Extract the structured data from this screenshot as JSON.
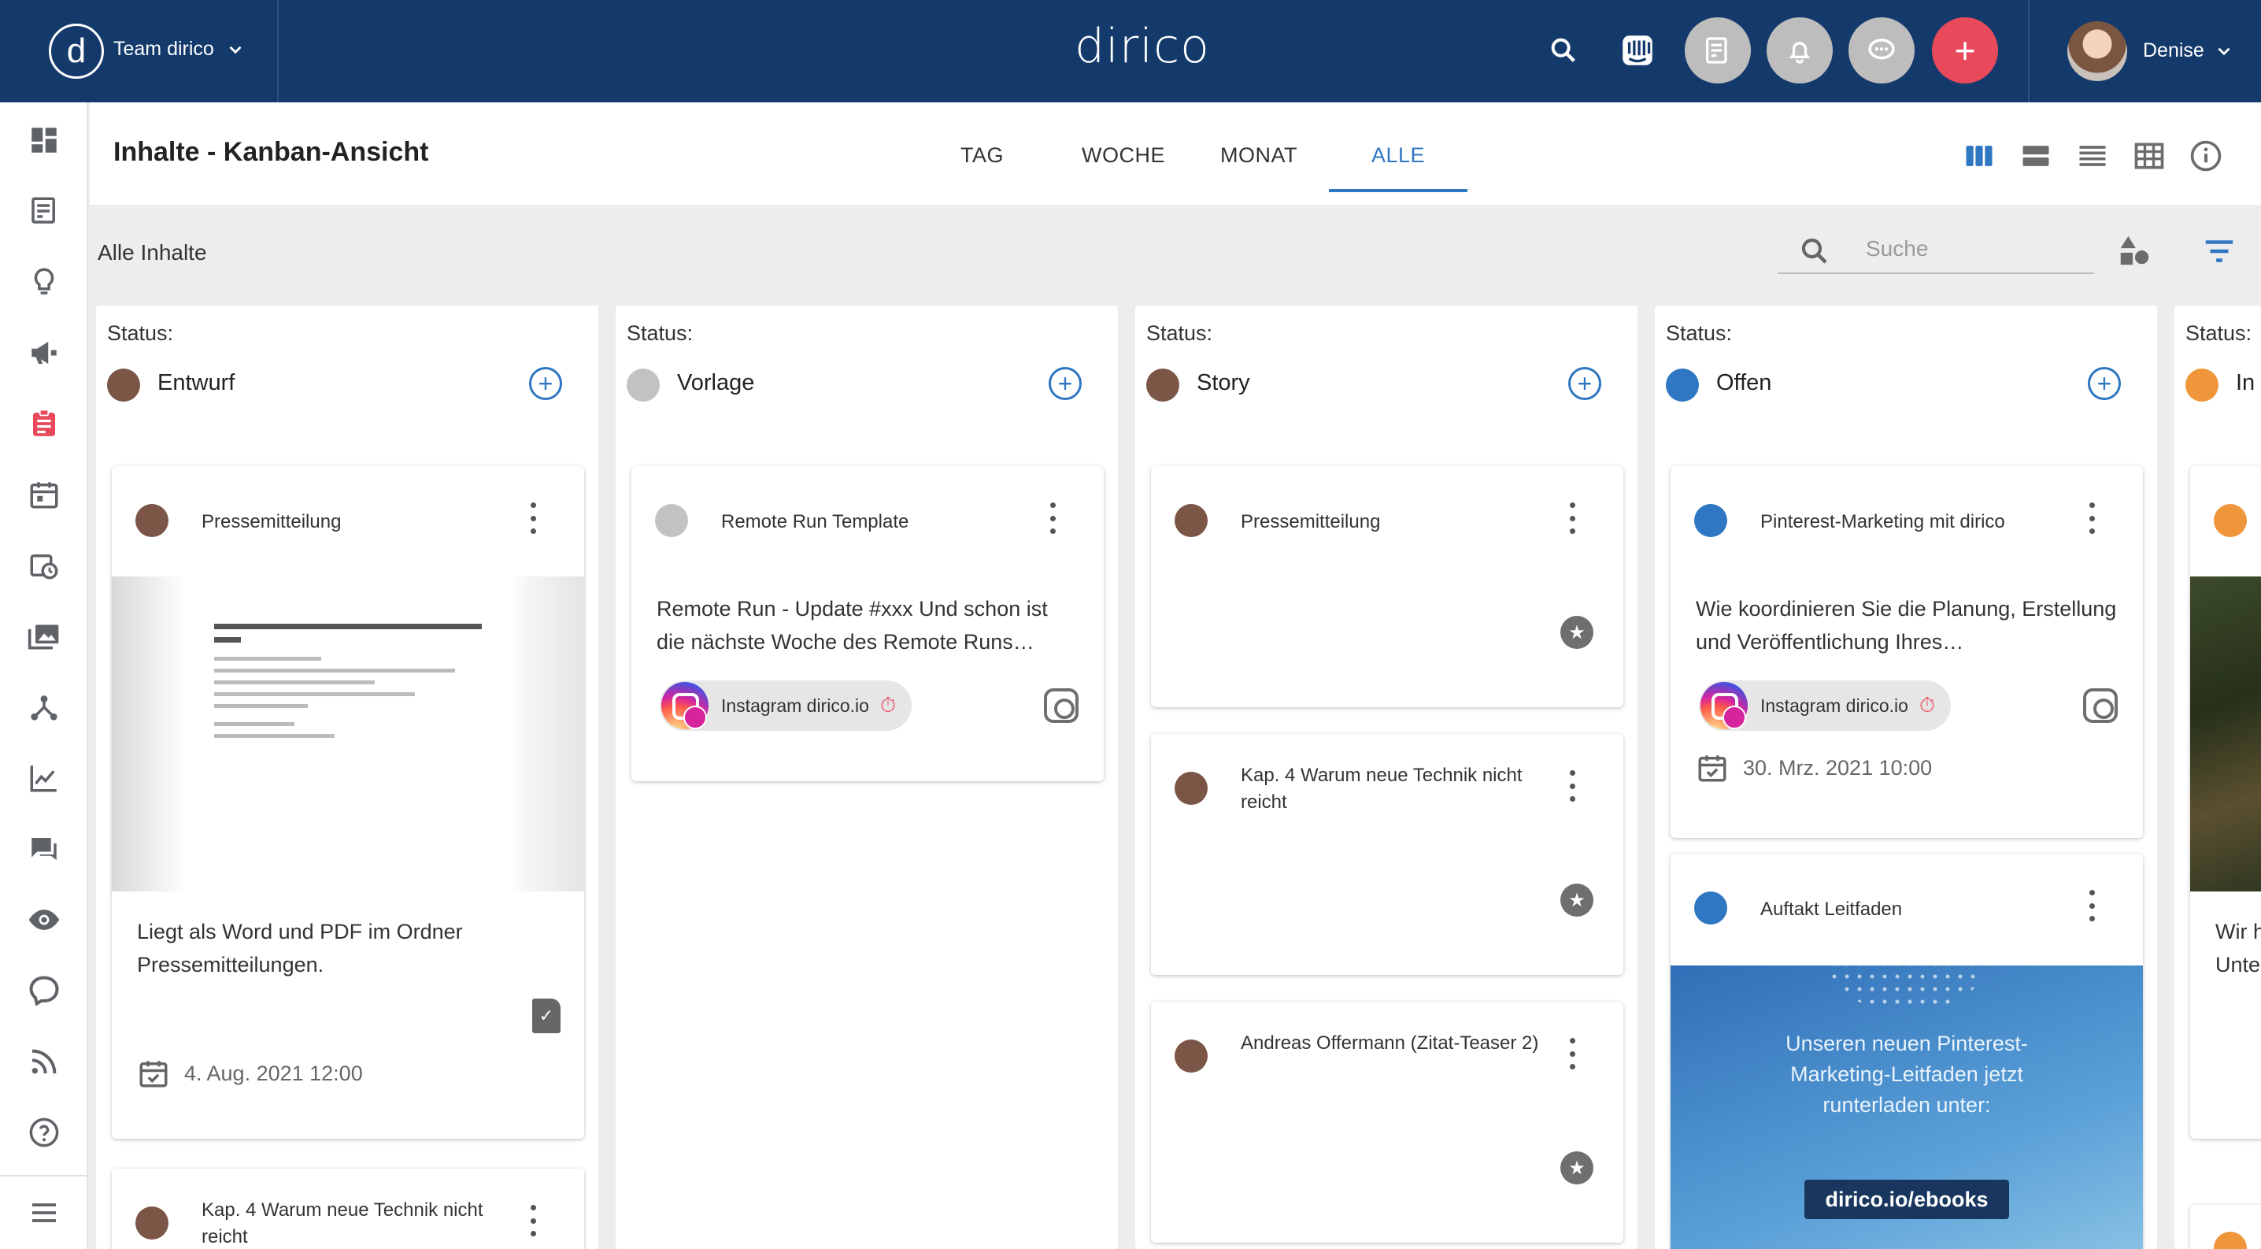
{
  "topbar": {
    "team_label": "Team dirico",
    "logo_text": "dirico",
    "brand_letter": "d",
    "user_name": "Denise",
    "add_label": "+",
    "colors": {
      "bar": "#143a6b",
      "add": "#e8495b"
    }
  },
  "page": {
    "title": "Inhalte - Kanban-Ansicht",
    "tabs": [
      "TAG",
      "WOCHE",
      "MONAT",
      "ALLE"
    ],
    "active_tab": "ALLE",
    "section_label": "Alle Inhalte",
    "search_placeholder": "Suche"
  },
  "columns": [
    {
      "status_label": "Status:",
      "name": "Entwurf",
      "color": "#7b5546",
      "cards": [
        {
          "title": "Pressemitteilung",
          "body": "Liegt als Word und PDF im Ordner Pressemitteilungen.",
          "date": "4. Aug. 2021 12:00"
        },
        {
          "title": "Kap. 4 Warum neue Technik nicht reicht"
        }
      ]
    },
    {
      "status_label": "Status:",
      "name": "Vorlage",
      "color": "#c2c2c2",
      "cards": [
        {
          "title": "Remote Run Template",
          "body": "Remote Run - Update #xxx Und schon ist die nächste Woche des Remote Runs…",
          "channel": "Instagram dirico.io"
        }
      ]
    },
    {
      "status_label": "Status:",
      "name": "Story",
      "color": "#7b5546",
      "cards": [
        {
          "title": "Pressemitteilung"
        },
        {
          "title": "Kap. 4 Warum neue Technik nicht reicht"
        },
        {
          "title": "Andreas Offermann (Zitat-Teaser 2)"
        }
      ]
    },
    {
      "status_label": "Status:",
      "name": "Offen",
      "color": "#2f77c3",
      "cards": [
        {
          "title": "Pinterest-Marketing mit dirico",
          "body": "Wie koordinieren Sie die Planung, Erstellung und Veröffentlichung Ihres…",
          "channel": "Instagram dirico.io",
          "date": "30. Mrz. 2021 10:00"
        },
        {
          "title": "Auftakt Leitfaden",
          "image_text": "Unseren neuen Pinterest-Marketing-Leitfaden jetzt runterladen unter:",
          "image_tag": "dirico.io/ebooks"
        }
      ]
    },
    {
      "status_label": "Status:",
      "name": "In",
      "color": "#f0963a",
      "cards": [
        {
          "body_partial": "Wir h Unte"
        }
      ]
    }
  ]
}
